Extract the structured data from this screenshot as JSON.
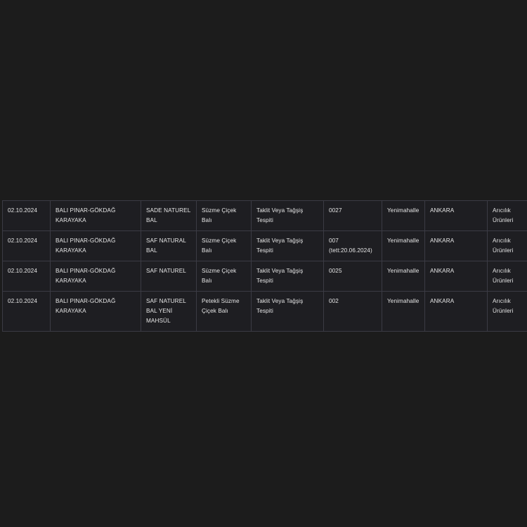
{
  "page": {
    "background_color": "#1c1c1c",
    "text_color": "#e6e6e6",
    "border_color": "#3b3b44"
  },
  "table": {
    "name": "taklit-tagsis-tespiti-table",
    "columns": [
      "date",
      "firm",
      "product",
      "product_type",
      "inspection_type",
      "batch",
      "district",
      "city",
      "category"
    ],
    "rows": [
      {
        "date": "02.10.2024",
        "firm_line1": "BALI PINAR-GÖKDAĞ",
        "firm_line2": "KARAYAKA",
        "product_line1": "SADE NATUREL",
        "product_line2": "BAL",
        "product_line3": "",
        "type_line1": "Süzme Çiçek",
        "type_line2": "Balı",
        "inspection_line1": "Taklit Veya Tağşiş",
        "inspection_line2": "Tespiti",
        "batch_line1": "0027",
        "batch_line2": "",
        "district": "Yenimahalle",
        "city": "ANKARA",
        "category_line1": "Arıcılık",
        "category_line2": "Ürünleri"
      },
      {
        "date": "02.10.2024",
        "firm_line1": "BALI PINAR-GÖKDAĞ",
        "firm_line2": "KARAYAKA",
        "product_line1": "SAF NATURAL",
        "product_line2": "BAL",
        "product_line3": "",
        "type_line1": "Süzme Çiçek",
        "type_line2": "Balı",
        "inspection_line1": "Taklit Veya Tağşiş",
        "inspection_line2": "Tespiti",
        "batch_line1": "007",
        "batch_line2": "(tett:20.06.2024)",
        "district": "Yenimahalle",
        "city": "ANKARA",
        "category_line1": "Arıcılık",
        "category_line2": "Ürünleri"
      },
      {
        "date": "02.10.2024",
        "firm_line1": "BALI PINAR-GÖKDAĞ",
        "firm_line2": "KARAYAKA",
        "product_line1": "SAF NATUREL",
        "product_line2": "",
        "product_line3": "",
        "type_line1": "Süzme Çiçek",
        "type_line2": "Balı",
        "inspection_line1": "Taklit Veya Tağşiş",
        "inspection_line2": "Tespiti",
        "batch_line1": "0025",
        "batch_line2": "",
        "district": "Yenimahalle",
        "city": "ANKARA",
        "category_line1": "Arıcılık",
        "category_line2": "Ürünleri"
      },
      {
        "date": "02.10.2024",
        "firm_line1": "BALI PINAR-GÖKDAĞ",
        "firm_line2": "KARAYAKA",
        "product_line1": "SAF NATUREL",
        "product_line2": "BAL YENİ",
        "product_line3": "MAHSÜL",
        "type_line1": "Petekli Süzme",
        "type_line2": "Çiçek Balı",
        "inspection_line1": "Taklit Veya Tağşiş",
        "inspection_line2": "Tespiti",
        "batch_line1": "002",
        "batch_line2": "",
        "district": "Yenimahalle",
        "city": "ANKARA",
        "category_line1": "Arıcılık",
        "category_line2": "Ürünleri"
      }
    ]
  }
}
